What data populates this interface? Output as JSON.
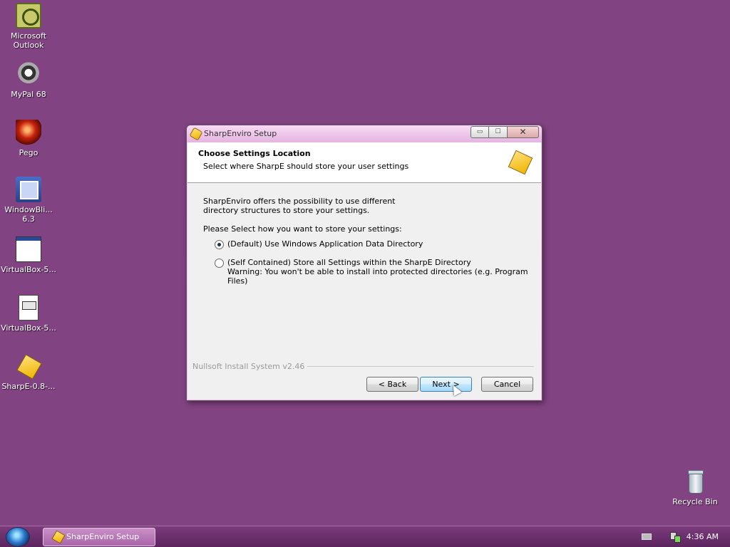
{
  "desktop": {
    "icons": [
      {
        "label": "Microsoft Outlook"
      },
      {
        "label": "MyPal 68"
      },
      {
        "label": "Pego"
      },
      {
        "label": "WindowBli... 6.3"
      },
      {
        "label": "VirtualBox-5..."
      },
      {
        "label": "VirtualBox-5..."
      },
      {
        "label": "SharpE-0.8-..."
      },
      {
        "label": "Recycle Bin"
      }
    ]
  },
  "window": {
    "title": "SharpEnviro Setup",
    "caption": {
      "minimize": "▭",
      "maximize": "☐",
      "close": "✕"
    },
    "header": {
      "title": "Choose Settings Location",
      "subtitle": "Select where SharpE should store your user settings"
    },
    "intro_line1": "SharpEnviro offers the possibility to use different",
    "intro_line2": "directory structures to store your settings.",
    "prompt": "Please Select how you want to store your settings:",
    "options": [
      {
        "label": "(Default) Use Windows Application Data Directory",
        "checked": true
      },
      {
        "label": "(Self Contained) Store all Settings within the SharpE Directory",
        "warning": "Warning: You won't be able to install into protected directories (e.g. Program Files)",
        "checked": false
      }
    ],
    "branding": "Nullsoft Install System v2.46",
    "buttons": {
      "back": "< Back",
      "next": "Next >",
      "cancel": "Cancel"
    }
  },
  "taskbar": {
    "task_label": "SharpEnviro Setup",
    "clock": "4:36 AM"
  }
}
